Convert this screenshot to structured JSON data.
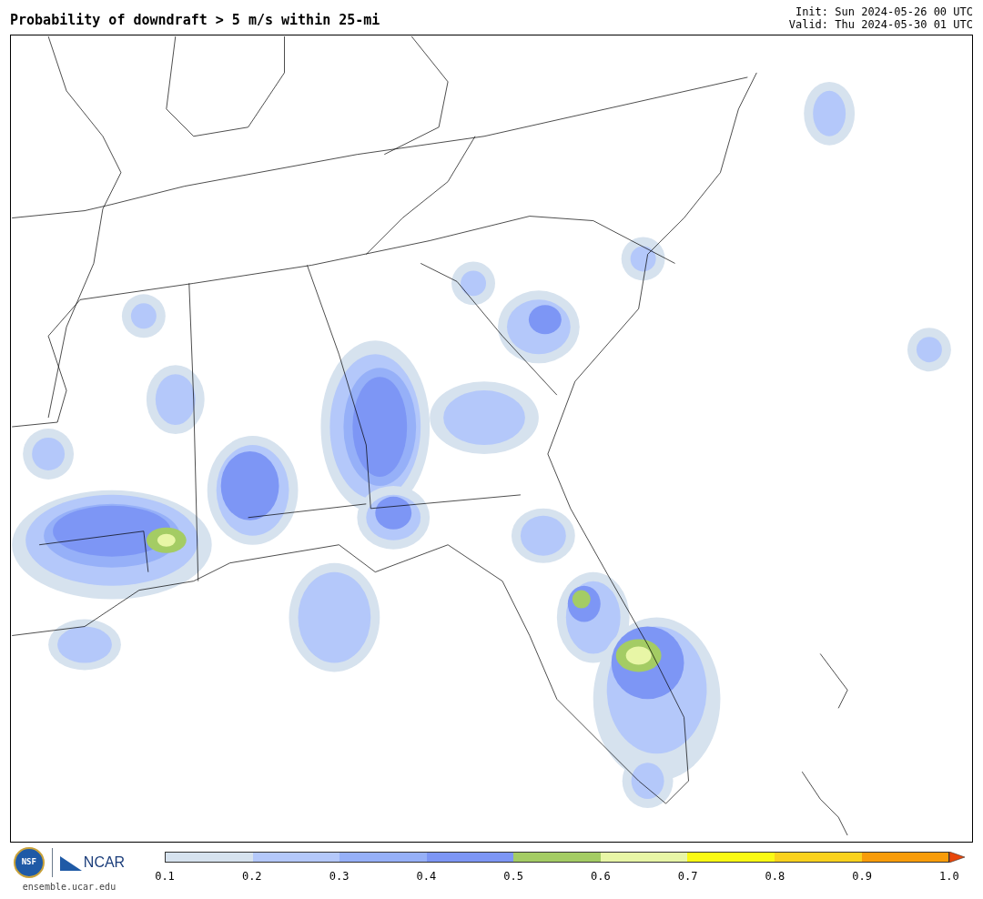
{
  "title": "Probability of downdraft > 5 m/s within 25-mi",
  "init": "Init: Sun 2024-05-26 00 UTC",
  "valid": "Valid: Thu 2024-05-30 01 UTC",
  "logos": {
    "nsf": "NSF",
    "ncar": "NCAR",
    "url": "ensemble.ucar.edu"
  },
  "colorbar": {
    "segments": [
      {
        "color": "#d6e2ee"
      },
      {
        "color": "#b4c8fa"
      },
      {
        "color": "#96b0f8"
      },
      {
        "color": "#7d96f5"
      },
      {
        "color": "#a4cc64"
      },
      {
        "color": "#e8f6a6"
      },
      {
        "color": "#fafa14"
      },
      {
        "color": "#fad21e"
      },
      {
        "color": "#f89c0a"
      }
    ],
    "extend": {
      "color": "#e8460a"
    },
    "ticks": [
      "0.1",
      "0.2",
      "0.3",
      "0.4",
      "0.5",
      "0.6",
      "0.7",
      "0.8",
      "0.9",
      "1.0"
    ]
  }
}
